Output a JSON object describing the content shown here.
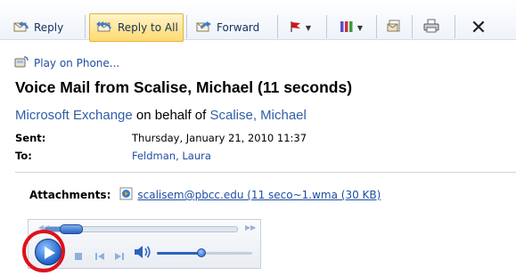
{
  "toolbar": {
    "reply_label": "Reply",
    "reply_all_label": "Reply to All",
    "forward_label": "Forward",
    "flag_icon": "flag-icon",
    "categorize_icon": "categorize-icon",
    "move_icon": "move-to-folder-icon",
    "print_icon": "print-icon",
    "close_label": "✕"
  },
  "message": {
    "play_on_phone": "Play on Phone...",
    "subject": "Voice Mail from Scalise, Michael (11 seconds)",
    "from_sender": "Microsoft Exchange",
    "from_on_behalf": " on behalf of ",
    "from_delegate": "Scalise, Michael",
    "sent_label": "Sent:",
    "sent_value": "Thursday, January 21, 2010 11:37",
    "to_label": "To:",
    "to_value": "Feldman, Laura",
    "attachments_label": "Attachments:",
    "attachment_file": "scalisem@pbcc.edu (11 seco~1.wma (30 KB)"
  },
  "player": {
    "seek_position": 0.09,
    "volume_level": 0.47,
    "highlight_color": "#e0101a",
    "accent_color": "#1d5fc7"
  }
}
